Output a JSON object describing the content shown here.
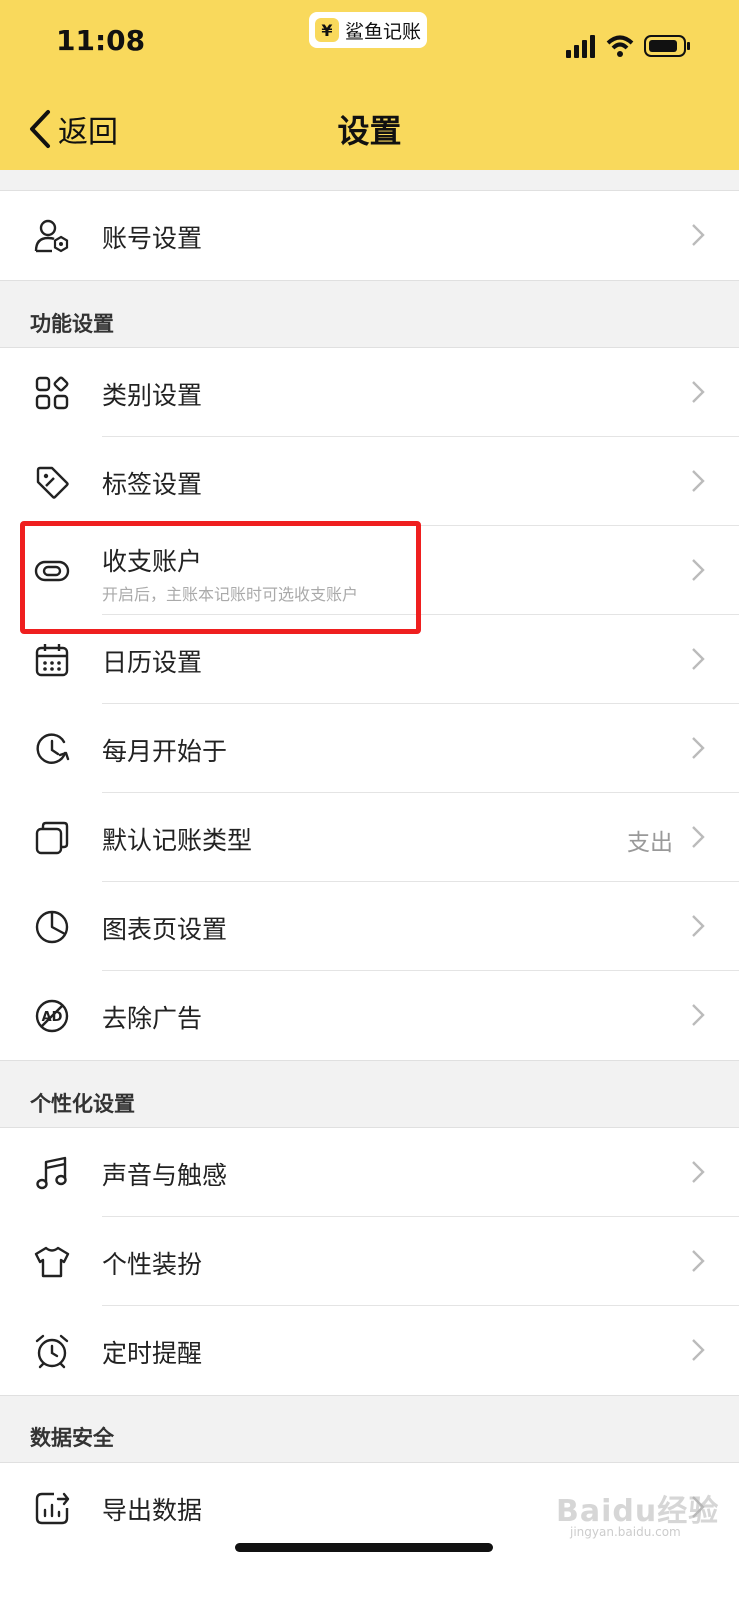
{
  "status_bar": {
    "time": "11:08"
  },
  "app_pill": {
    "symbol": "¥",
    "name": "鲨鱼记账"
  },
  "nav": {
    "back_label": "返回",
    "title": "设置"
  },
  "account_row": {
    "label": "账号设置",
    "icon": "user-settings-icon"
  },
  "sections": {
    "function": "功能设置",
    "personal": "个性化设置",
    "data": "数据安全"
  },
  "function_rows": [
    {
      "label": "类别设置",
      "icon": "category-icon"
    },
    {
      "label": "标签设置",
      "icon": "tag-icon"
    },
    {
      "label": "收支账户",
      "sub": "开启后，主账本记账时可选收支账户",
      "icon": "link-icon"
    },
    {
      "label": "日历设置",
      "icon": "calendar-icon"
    },
    {
      "label": "每月开始于",
      "icon": "clock-refresh-icon"
    },
    {
      "label": "默认记账类型",
      "value": "支出",
      "icon": "copy-icon"
    },
    {
      "label": "图表页设置",
      "icon": "pie-chart-icon"
    },
    {
      "label": "去除广告",
      "icon": "no-ad-icon"
    }
  ],
  "personal_rows": [
    {
      "label": "声音与触感",
      "icon": "music-icon"
    },
    {
      "label": "个性装扮",
      "icon": "shirt-icon"
    },
    {
      "label": "定时提醒",
      "icon": "alarm-icon"
    }
  ],
  "data_rows": [
    {
      "label": "导出数据",
      "icon": "export-icon"
    }
  ],
  "watermark": {
    "text": "Baidu经验",
    "sub": "jingyan.baidu.com"
  }
}
